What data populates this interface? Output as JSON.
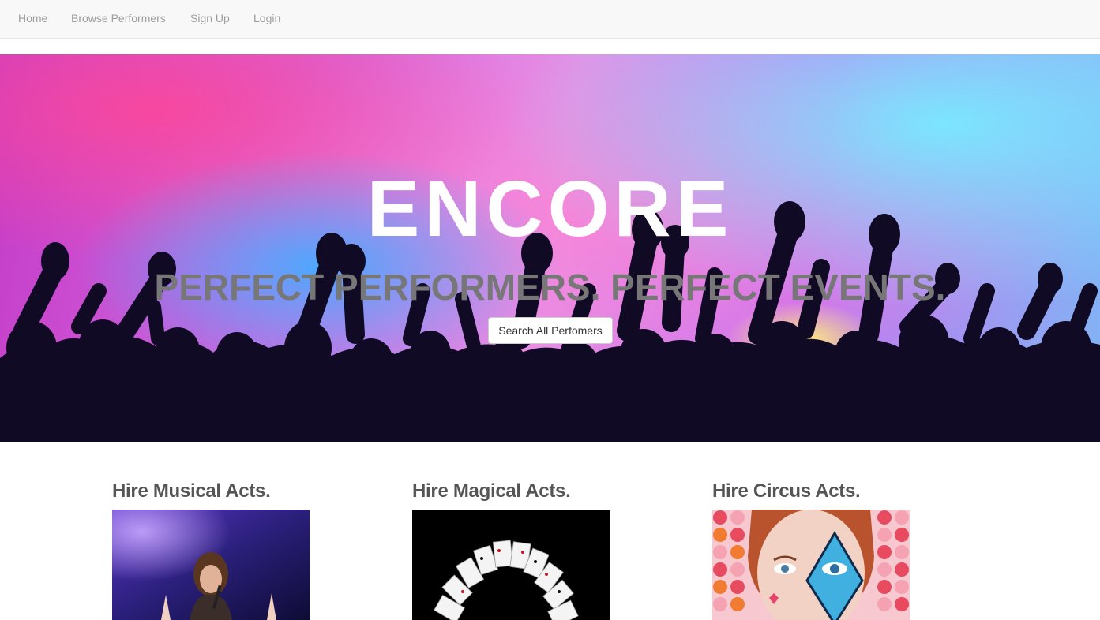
{
  "navbar": {
    "links": [
      {
        "label": "Home"
      },
      {
        "label": "Browse Performers"
      },
      {
        "label": "Sign Up"
      },
      {
        "label": "Login"
      }
    ],
    "link_color": "#9d9d9d"
  },
  "hero": {
    "title": "ENCORE",
    "tagline": "PERFECT PERFORMERS. PERFECT EVENTS.",
    "button_label": "Search All Perfomers",
    "image": "concert-crowd-image"
  },
  "acts": [
    {
      "heading": "Hire Musical Acts.",
      "image": "singer-on-stage-image"
    },
    {
      "heading": "Hire Magical Acts.",
      "image": "playing-cards-fan-image"
    },
    {
      "heading": "Hire Circus Acts.",
      "image": "face-paint-performer-image"
    }
  ],
  "colors": {
    "heading_text": "#555555",
    "tagline_text": "#777777",
    "nav_background": "#f8f8f8"
  }
}
